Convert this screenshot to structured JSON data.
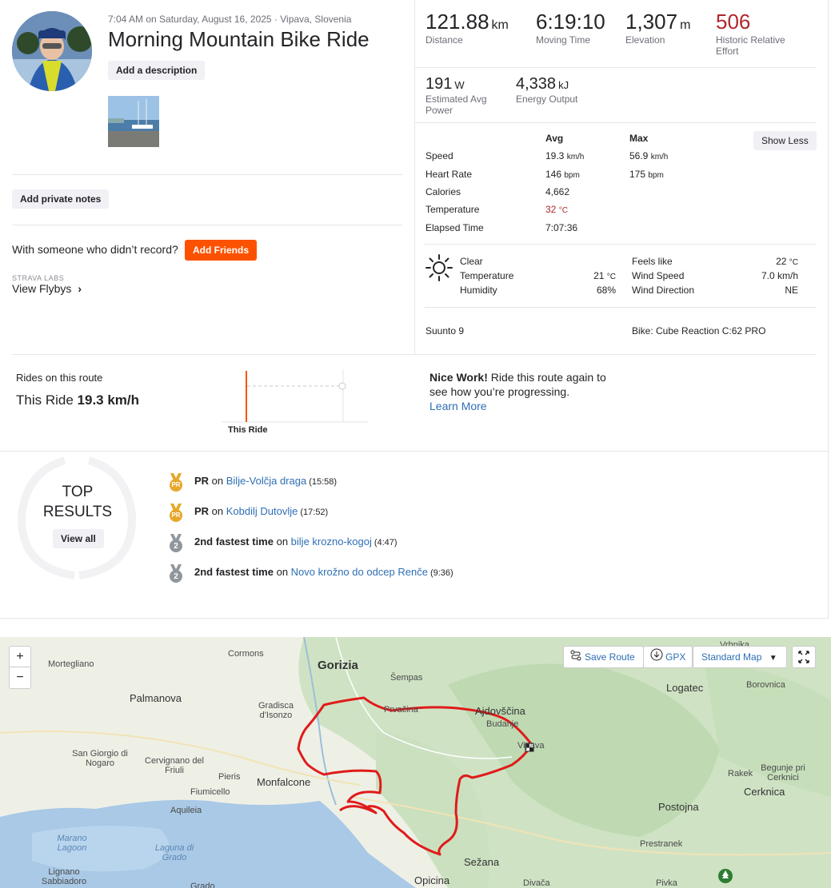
{
  "activity": {
    "meta": "7:04 AM on Saturday, August 16, 2025 · Vipava, Slovenia",
    "title": "Morning Mountain Bike Ride",
    "add_description": "Add a description",
    "add_private_notes": "Add private notes",
    "with_someone": "With someone who didn’t record?",
    "add_friends": "Add Friends",
    "labs_label": "STRAVA LABS",
    "flybys": "View Flybys"
  },
  "stats": {
    "distance": {
      "value": "121.88",
      "unit": "km",
      "label": "Distance"
    },
    "moving_time": {
      "value": "6:19:10",
      "label": "Moving Time"
    },
    "elevation": {
      "value": "1,307",
      "unit": "m",
      "label": "Elevation"
    },
    "effort": {
      "value": "506",
      "label": "Historic Relative Effort"
    },
    "power": {
      "value": "191",
      "unit": "W",
      "label": "Estimated Avg Power"
    },
    "energy": {
      "value": "4,338",
      "unit": "kJ",
      "label": "Energy Output"
    }
  },
  "details": {
    "col_avg": "Avg",
    "col_max": "Max",
    "show_less": "Show Less",
    "rows": [
      {
        "label": "Speed",
        "avg": "19.3",
        "avg_unit": "km/h",
        "max": "56.9",
        "max_unit": "km/h"
      },
      {
        "label": "Heart Rate",
        "avg": "146",
        "avg_unit": "bpm",
        "max": "175",
        "max_unit": "bpm"
      },
      {
        "label": "Calories",
        "avg": "4,662",
        "avg_unit": "",
        "max": "",
        "max_unit": ""
      },
      {
        "label": "Temperature",
        "avg": "32",
        "avg_unit": "°C",
        "max": "",
        "max_unit": ""
      },
      {
        "label": "Elapsed Time",
        "avg": "7:07:36",
        "avg_unit": "",
        "max": "",
        "max_unit": ""
      }
    ]
  },
  "weather": {
    "condition": "Clear",
    "temp_label": "Temperature",
    "temp": "21",
    "temp_unit": "°C",
    "humidity_label": "Humidity",
    "humidity": "68%",
    "feels_label": "Feels like",
    "feels": "22",
    "feels_unit": "°C",
    "wind_speed_label": "Wind Speed",
    "wind_speed": "7.0 km/h",
    "wind_dir_label": "Wind Direction",
    "wind_dir": "NE"
  },
  "device": "Suunto 9",
  "bike": "Bike: Cube Reaction C:62 PRO",
  "route": {
    "heading": "Rides on this route",
    "this_ride_prefix": "This Ride",
    "this_ride_value": "19.3 km/h",
    "chart_label": "This Ride",
    "nice_work": "Nice Work!",
    "nice_text": " Ride this route again to see how you’re progressing.",
    "learn_more": "Learn More"
  },
  "top": {
    "line1": "TOP",
    "line2": "RESULTS",
    "view_all": "View all",
    "results": [
      {
        "badge": "PR",
        "bold": "PR",
        "on": " on ",
        "segment": "Bilje-Volčja draga",
        "time": "(15:58)"
      },
      {
        "badge": "PR",
        "bold": "PR",
        "on": " on ",
        "segment": "Kobdilj Dutovlje",
        "time": "(17:52)"
      },
      {
        "badge": "2",
        "bold": "2nd fastest time",
        "on": " on ",
        "segment": "bilje krozno-kogoj",
        "time": "(4:47)"
      },
      {
        "badge": "2",
        "bold": "2nd fastest time",
        "on": " on ",
        "segment": "Novo krožno do odcep Renče",
        "time": "(9:36)"
      }
    ]
  },
  "map": {
    "zoom_in": "+",
    "zoom_out": "−",
    "save_route": "Save Route",
    "gpx": "GPX",
    "style": "Standard Map",
    "places": [
      "Mortegliano",
      "Cormons",
      "Gorizia",
      "Šempas",
      "Vrhnika",
      "Palmanova",
      "Prvačina",
      "Ajdovščina",
      "Logatec",
      "Borovnica",
      "Gradisca d'Isonzo",
      "Budanje",
      "Vipava",
      "San Giorgio di Nogaro",
      "Cervignano del Friuli",
      "Pieris",
      "Monfalcone",
      "Rakek",
      "Begunje pri Cerknici",
      "Cerknica",
      "Fiumicello",
      "Aquileia",
      "Postojna",
      "Marano Lagoon",
      "Laguna di Grado",
      "Prestranek",
      "Sežana",
      "Lignano Sabbiadoro",
      "Grado",
      "Opicina",
      "Divača",
      "Pivka"
    ]
  }
}
